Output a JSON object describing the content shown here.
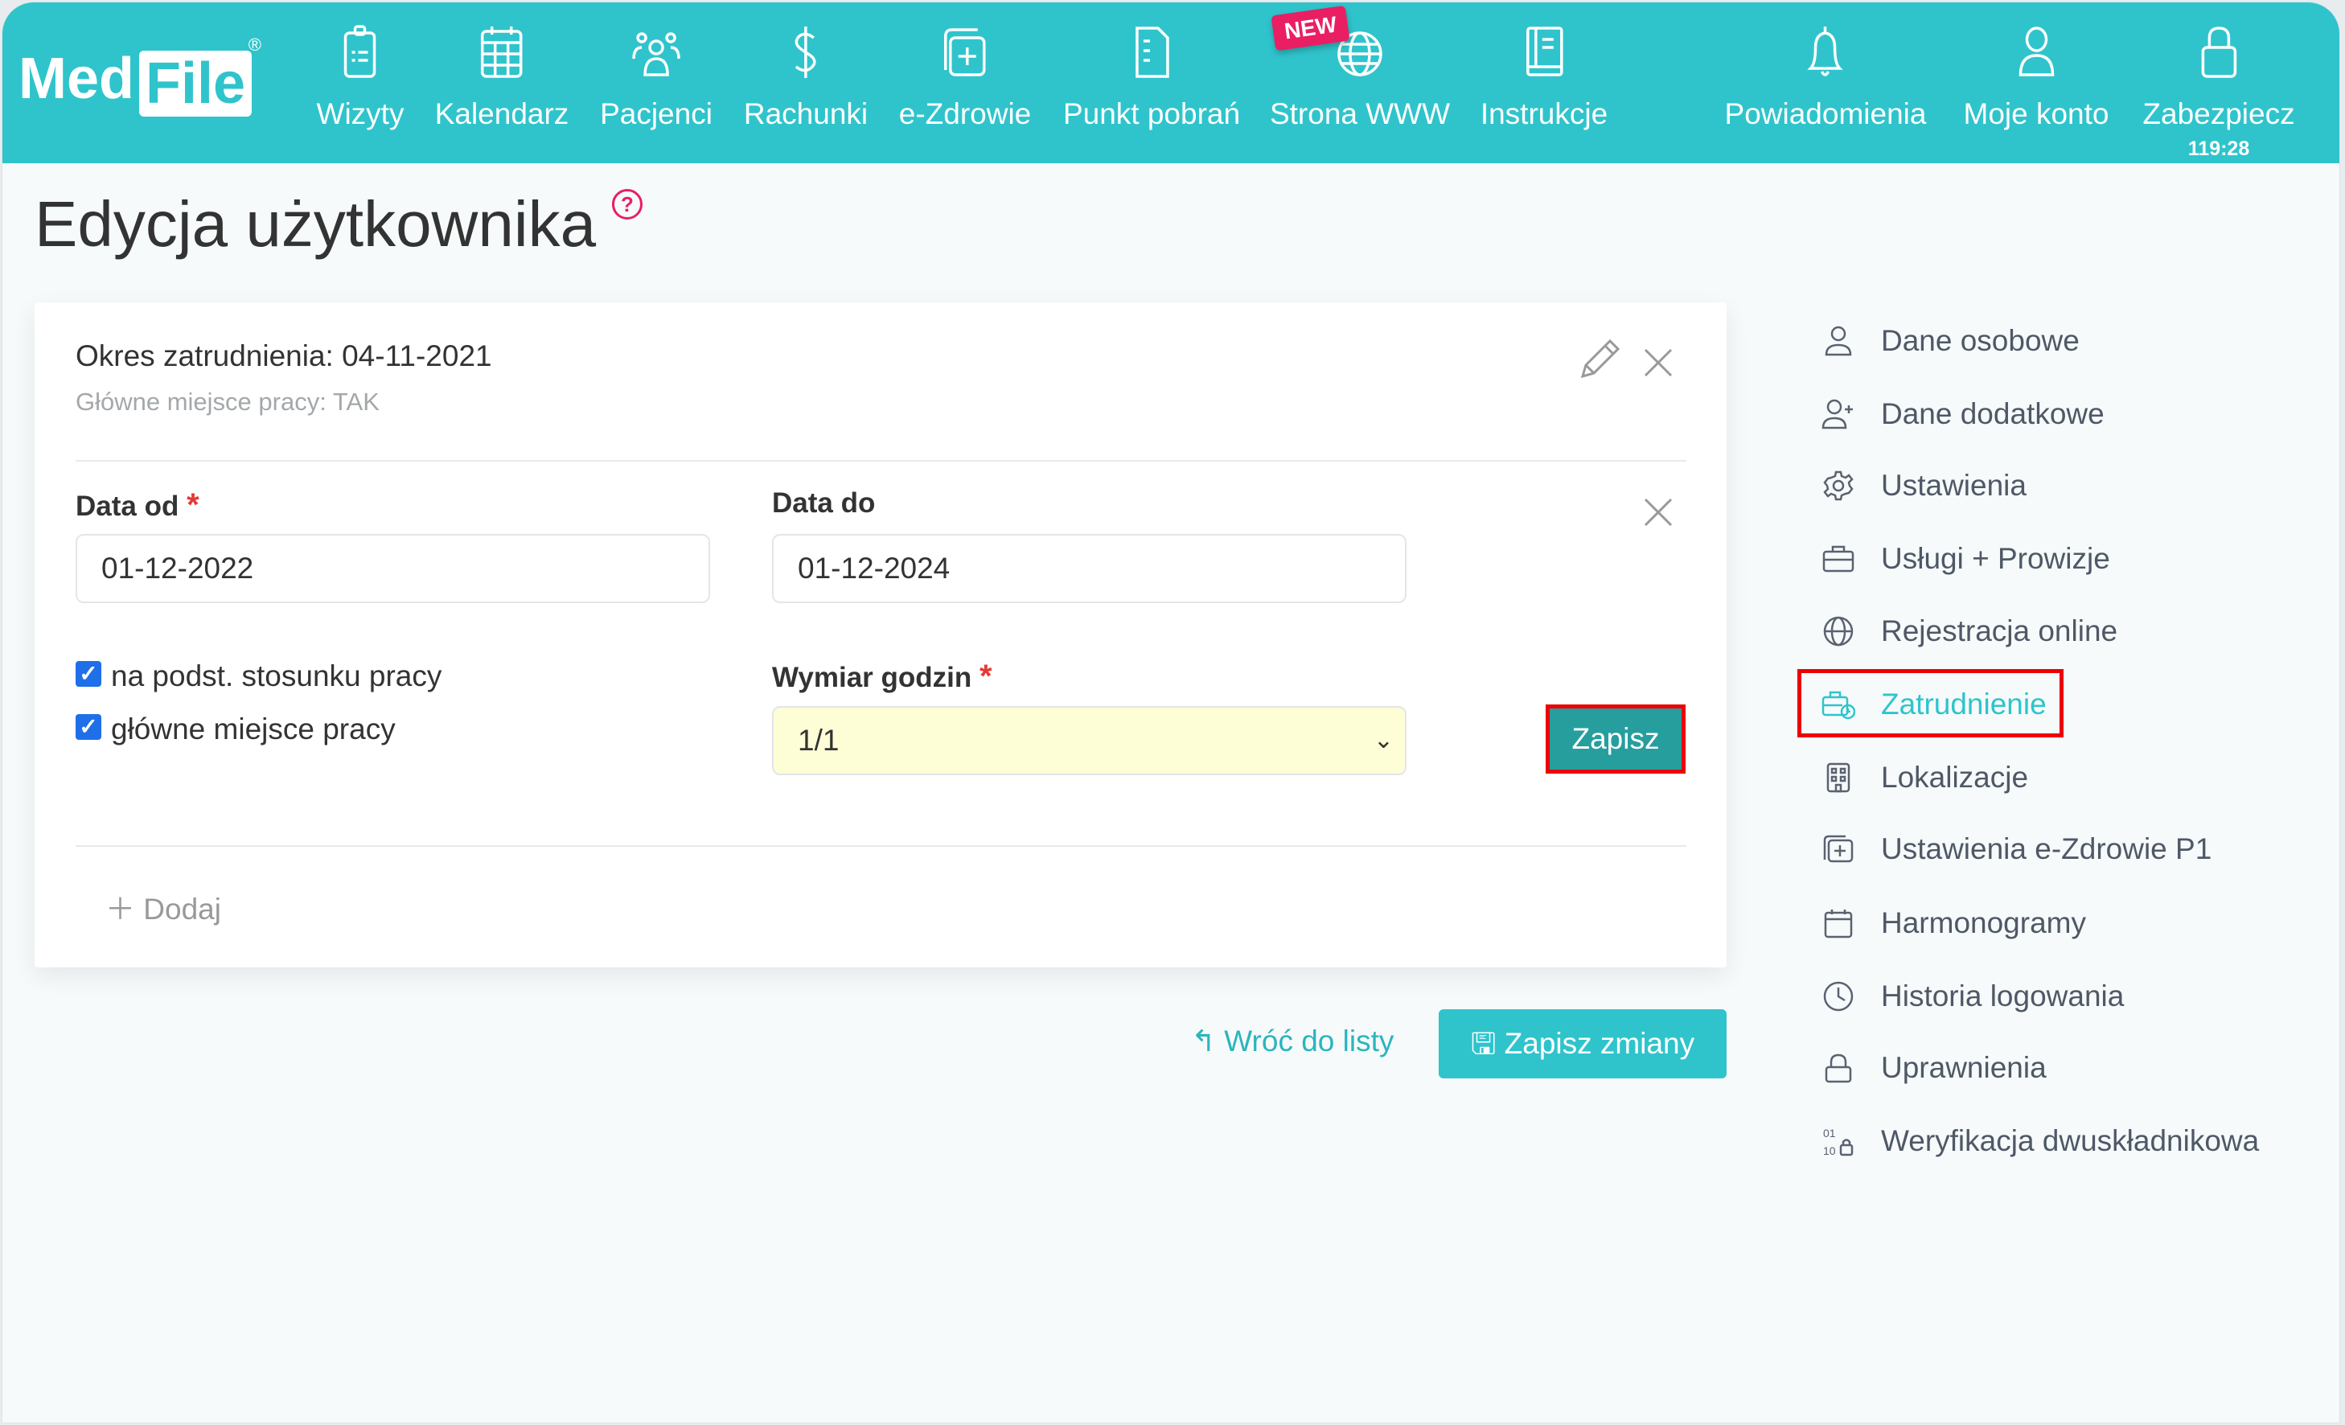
{
  "app": {
    "logo": "MedFile"
  },
  "nav": [
    {
      "label": "Wizyty",
      "icon": "clipboard-icon"
    },
    {
      "label": "Kalendarz",
      "icon": "calendar-icon"
    },
    {
      "label": "Pacjenci",
      "icon": "users-icon"
    },
    {
      "label": "Rachunki",
      "icon": "dollar-icon"
    },
    {
      "label": "e-Zdrowie",
      "icon": "medical-card-icon"
    },
    {
      "label": "Punkt pobrań",
      "icon": "document-icon"
    },
    {
      "label": "Strona WWW",
      "icon": "globe-icon",
      "badge": "NEW"
    },
    {
      "label": "Instrukcje",
      "icon": "book-icon"
    },
    {
      "label": "Powiadomienia",
      "icon": "bell-icon"
    },
    {
      "label": "Moje konto",
      "icon": "user-icon"
    },
    {
      "label": "Zabezpiecz",
      "icon": "lock-icon",
      "timer": "119:28"
    }
  ],
  "page": {
    "title": "Edycja użytkownika",
    "help": "?"
  },
  "card": {
    "period": "Okres zatrudnienia: 04-11-2021",
    "main_place": "Główne miejsce pracy: TAK",
    "date_from_label": "Data od",
    "date_from": "01-12-2022",
    "date_to_label": "Data do",
    "date_to": "01-12-2024",
    "required": "*",
    "checkbox1": {
      "label": "na podst. stosunku pracy",
      "checked": true
    },
    "checkbox2": {
      "label": "główne miejsce pracy",
      "checked": true
    },
    "hours_label": "Wymiar godzin",
    "hours_value": "1/1",
    "save": "Zapisz",
    "add": "Dodaj"
  },
  "footer": {
    "back": "Wróć do listy",
    "save_changes": "Zapisz zmiany"
  },
  "sidebar": {
    "active": "Zatrudnienie",
    "items": [
      {
        "label": "Dane osobowe",
        "icon": "user-icon"
      },
      {
        "label": "Dane dodatkowe",
        "icon": "user-plus-icon"
      },
      {
        "label": "Ustawienia",
        "icon": "gear-icon"
      },
      {
        "label": "Usługi + Prowizje",
        "icon": "briefcase-icon"
      },
      {
        "label": "Rejestracja online",
        "icon": "globe-icon"
      },
      {
        "label": "Zatrudnienie",
        "icon": "briefcase-clock-icon"
      },
      {
        "label": "Lokalizacje",
        "icon": "building-icon"
      },
      {
        "label": "Ustawienia e-Zdrowie P1",
        "icon": "medical-card-icon"
      },
      {
        "label": "Harmonogramy",
        "icon": "calendar-icon"
      },
      {
        "label": "Historia logowania",
        "icon": "clock-icon"
      },
      {
        "label": "Uprawnienia",
        "icon": "lock-icon"
      },
      {
        "label": "Weryfikacja dwuskładnikowa",
        "icon": "two-factor-icon"
      }
    ]
  },
  "colors": {
    "brand": "#2fc4cc",
    "badge": "#e91e63",
    "highlight": "#ee0000",
    "save_button": "#279e9e",
    "select_bg": "#fdfdd6"
  }
}
